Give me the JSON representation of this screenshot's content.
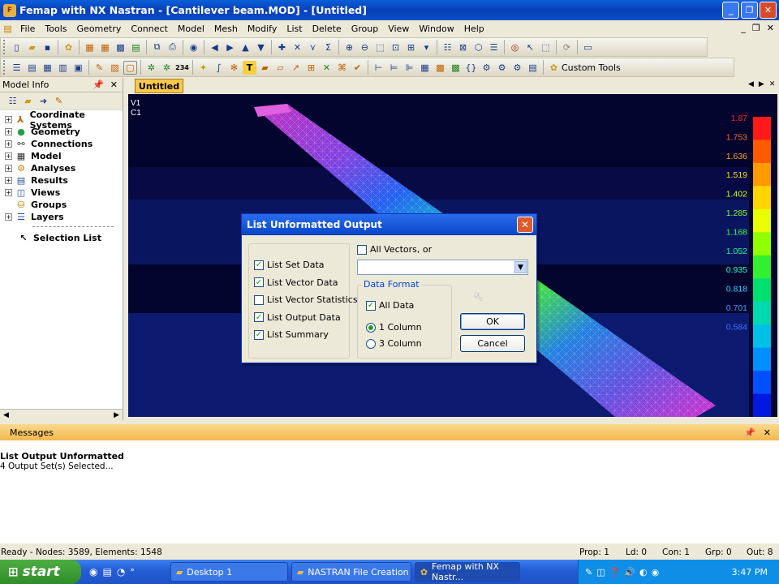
{
  "window": {
    "title": "Femap with NX Nastran - [Cantilever beam.MOD] - [Untitled]"
  },
  "menu": [
    "File",
    "Tools",
    "Geometry",
    "Connect",
    "Model",
    "Mesh",
    "Modify",
    "List",
    "Delete",
    "Group",
    "View",
    "Window",
    "Help"
  ],
  "toolbar": {
    "custom_tools": "Custom Tools",
    "counter_label": "234"
  },
  "model_info": {
    "title": "Model Info",
    "items": [
      {
        "label": "Coordinate Systems",
        "icon": "axes-icon"
      },
      {
        "label": "Geometry",
        "icon": "sphere-icon"
      },
      {
        "label": "Connections",
        "icon": "connection-icon"
      },
      {
        "label": "Model",
        "icon": "mesh-icon"
      },
      {
        "label": "Analyses",
        "icon": "analysis-icon"
      },
      {
        "label": "Results",
        "icon": "results-icon"
      },
      {
        "label": "Views",
        "icon": "view-icon"
      },
      {
        "label": "Groups",
        "icon": "group-icon"
      },
      {
        "label": "Layers",
        "icon": "layers-icon"
      }
    ],
    "selection_list": "Selection List"
  },
  "view": {
    "tab": "Untitled",
    "labels": [
      "V1",
      "C1"
    ],
    "legend_values": [
      "1.87",
      "1.753",
      "1.636",
      "1.519",
      "1.402",
      "1.285",
      "1.168",
      "1.052",
      "0.935",
      "0.818",
      "0.701",
      "0.584"
    ],
    "legend_colors": [
      "#ff1a1a",
      "#ff5a00",
      "#ff9a00",
      "#ffd400",
      "#e8ff00",
      "#90ff00",
      "#30f030",
      "#00e070",
      "#00d8b0",
      "#00c0e8",
      "#0090ff",
      "#0050ff",
      "#0018e0"
    ],
    "legend_text_colors": [
      "#ff2020",
      "#ff6a20",
      "#ffa020",
      "#ffd820",
      "#c8ff20",
      "#80ff20",
      "#30ff40",
      "#20ff90",
      "#20ffd0",
      "#20d8ff",
      "#40a0ff",
      "#4070ff"
    ]
  },
  "dialog": {
    "title": "List Unformatted Output",
    "options": [
      {
        "label": "List Set Data",
        "checked": true
      },
      {
        "label": "List Vector Data",
        "checked": true
      },
      {
        "label": "List Vector Statistics",
        "checked": false
      },
      {
        "label": "List Output Data",
        "checked": true
      },
      {
        "label": "List Summary",
        "checked": true
      }
    ],
    "all_vectors": {
      "label": "All Vectors, or",
      "checked": false
    },
    "vector_select": "",
    "data_format": {
      "legend": "Data Format",
      "all_data": {
        "label": "All Data",
        "checked": true
      },
      "radios": [
        {
          "label": "1 Column",
          "selected": true
        },
        {
          "label": "3 Column",
          "selected": false
        }
      ]
    },
    "ok": "OK",
    "cancel": "Cancel"
  },
  "messages": {
    "title": "Messages",
    "lines": [
      "List Output Unformatted",
      "4 Output Set(s) Selected..."
    ]
  },
  "status": {
    "left": "Ready - Nodes: 3589,  Elements: 1548",
    "prop": "Prop: 1",
    "ld": "Ld: 0",
    "con": "Con: 1",
    "grp": "Grp: 0",
    "out": "Out: 8"
  },
  "taskbar": {
    "start": "start",
    "tasks": [
      {
        "label": "Desktop 1",
        "active": false
      },
      {
        "label": "NASTRAN File Creation",
        "active": false
      },
      {
        "label": "Femap with NX Nastr...",
        "active": true
      }
    ],
    "time": "3:47 PM"
  }
}
